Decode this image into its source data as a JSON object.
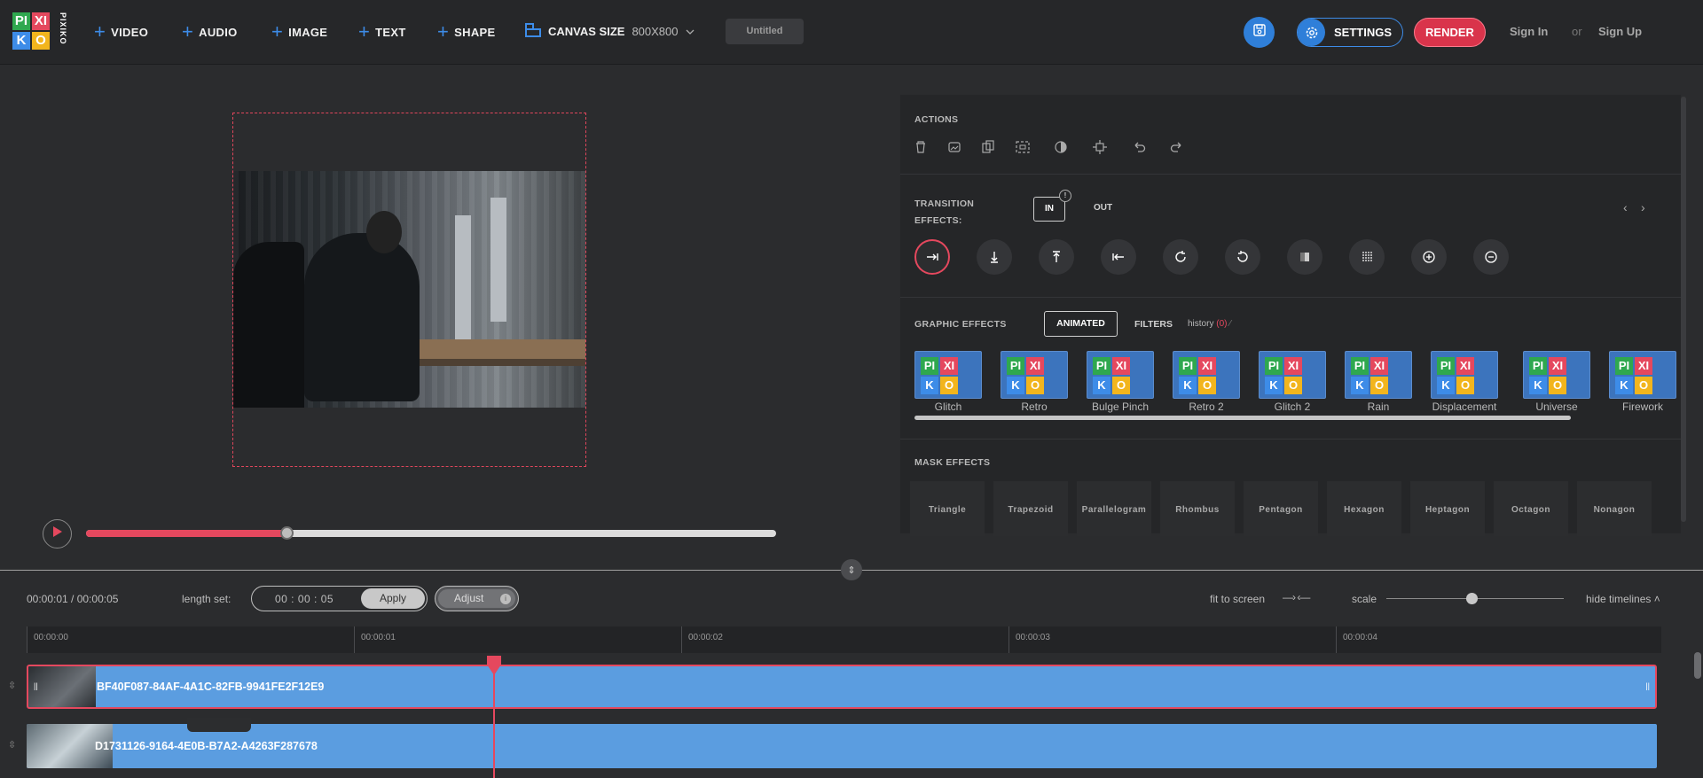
{
  "header": {
    "logo": {
      "letters": [
        "PI",
        "XI",
        "K",
        "O",
        "PIXIKO"
      ],
      "colors": [
        "#2fa84f",
        "#e5485e",
        "#3d8ce8",
        "#f2b51d"
      ]
    },
    "add_buttons": [
      {
        "label": "VIDEO",
        "icon": "plus-icon"
      },
      {
        "label": "AUDIO",
        "icon": "plus-icon"
      },
      {
        "label": "IMAGE",
        "icon": "plus-icon"
      },
      {
        "label": "TEXT",
        "icon": "plus-icon"
      },
      {
        "label": "SHAPE",
        "icon": "plus-icon"
      }
    ],
    "canvas_size": {
      "label": "CANVAS SIZE",
      "value": "800X800"
    },
    "project_title": "Untitled",
    "settings_label": "SETTINGS",
    "render_label": "RENDER",
    "sign_in": "Sign In",
    "or": "or",
    "sign_up": "Sign Up",
    "accent": "#3d8ce8",
    "render_color": "#d9344b"
  },
  "player": {
    "progress": 0.29
  },
  "panel": {
    "actions_title": "ACTIONS",
    "action_icons": [
      "trash-icon",
      "image-replace-icon",
      "duplicate-icon",
      "fit-icon",
      "contrast-icon",
      "center-icon",
      "undo-icon",
      "redo-icon"
    ],
    "transition_title_line1": "TRANSITION",
    "transition_title_line2": "EFFECTS:",
    "tab_in": "IN",
    "tab_in_badge": "!",
    "tab_out": "OUT",
    "transitions": [
      "slide-right-icon",
      "slide-down-icon",
      "slide-up-icon",
      "slide-left-icon",
      "rotate-cw-icon",
      "rotate-ccw-icon",
      "fade-icon",
      "blinds-icon",
      "zoom-in-icon",
      "zoom-out-icon"
    ],
    "graphic_title": "GRAPHIC EFFECTS",
    "tab_animated": "ANIMATED",
    "tab_filters": "FILTERS",
    "history_label": "history",
    "history_count": "(0)",
    "effects": [
      "Glitch",
      "Retro",
      "Bulge Pinch",
      "Retro 2",
      "Glitch 2",
      "Rain",
      "Displacement",
      "Universe",
      "Firework"
    ],
    "mask_title": "MASK EFFECTS",
    "masks": [
      "Triangle",
      "Trapezoid",
      "Parallelogram",
      "Rhombus",
      "Pentagon",
      "Hexagon",
      "Heptagon",
      "Octagon",
      "Nonagon"
    ]
  },
  "timeline": {
    "time_info": "00:00:01 / 00:00:05",
    "length_label": "length set:",
    "length_value": "00 : 00 : 05",
    "apply_label": "Apply",
    "adjust_label": "Adjust",
    "adjust_info": "i",
    "fit_label": "fit to screen",
    "scale_label": "scale",
    "hide_label": "hide timelines",
    "ticks": [
      "00:00:00",
      "00:00:01",
      "00:00:02",
      "00:00:03",
      "00:00:04"
    ],
    "tracks": [
      {
        "name": "BF40F087-84AF-4A1C-82FB-9941FE2F12E9"
      },
      {
        "name": "D1731126-9164-4E0B-B7A2-A4263F287678"
      }
    ],
    "playhead_color": "#e5485e",
    "track_color": "#5b9de0"
  }
}
